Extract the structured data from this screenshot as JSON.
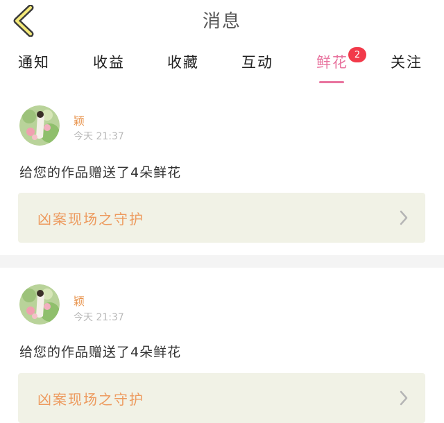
{
  "header": {
    "title": "消息",
    "back_icon": "chevron-left-icon"
  },
  "tabs": [
    {
      "label": "通知"
    },
    {
      "label": "收益"
    },
    {
      "label": "收藏"
    },
    {
      "label": "互动"
    },
    {
      "label": "鲜花",
      "active": true,
      "badge": "2"
    },
    {
      "label": "关注"
    }
  ],
  "colors": {
    "accent": "#e8739e",
    "badge": "#f23a4a",
    "username": "#e8944e",
    "work_title": "#ed9a5e",
    "card_bg": "#f1f2e6"
  },
  "messages": [
    {
      "username": "颖",
      "time": "今天 21:37",
      "text": "给您的作品赠送了4朵鲜花",
      "work_title": "凶案现场之守护"
    },
    {
      "username": "颖",
      "time": "今天 21:37",
      "text": "给您的作品赠送了4朵鲜花",
      "work_title": "凶案现场之守护"
    }
  ]
}
